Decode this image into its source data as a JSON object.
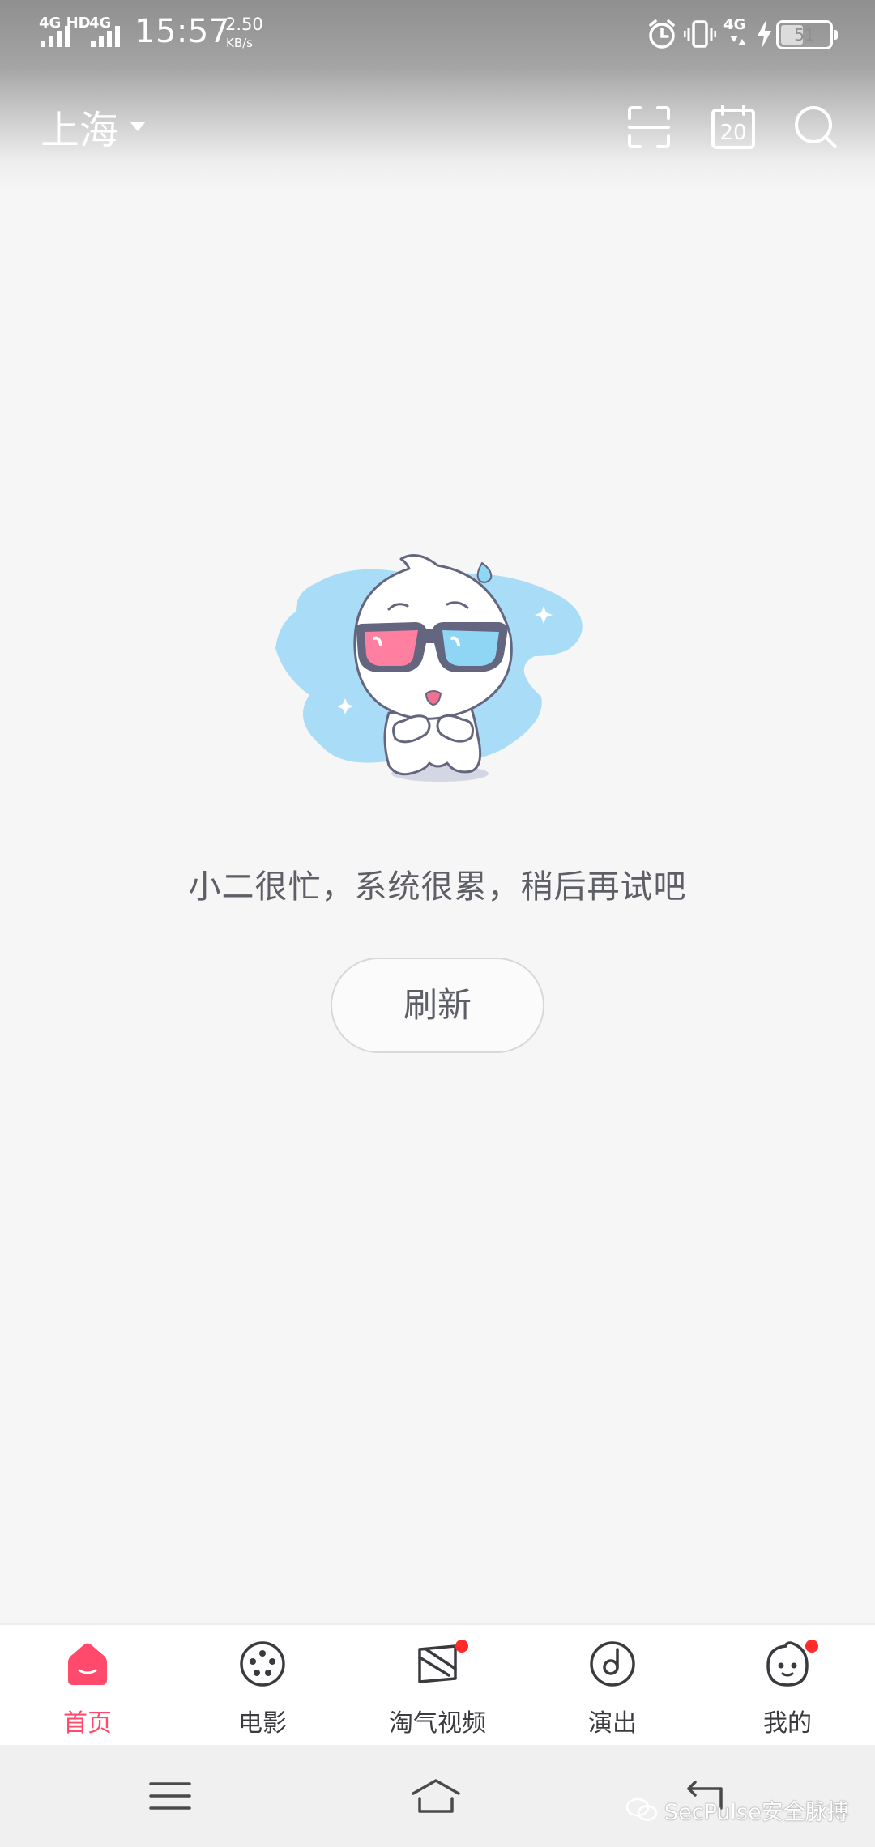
{
  "status_bar": {
    "sim1_label": "4G HD",
    "sim2_label": "4G",
    "time": "15:57",
    "speed_value": "2.50",
    "speed_unit": "KB/s",
    "network_right": "4G",
    "battery_level": "51"
  },
  "header": {
    "city": "上海",
    "calendar_day": "20",
    "icons": [
      "scan-icon",
      "calendar-icon",
      "search-icon"
    ]
  },
  "empty_state": {
    "message": "小二很忙，系统很累，稍后再试吧",
    "refresh_label": "刷新"
  },
  "tabs": [
    {
      "label": "首页",
      "icon": "home-icon",
      "active": true,
      "badge": false
    },
    {
      "label": "电影",
      "icon": "film-reel-icon",
      "active": false,
      "badge": false
    },
    {
      "label": "淘气视频",
      "icon": "video-icon",
      "active": false,
      "badge": true
    },
    {
      "label": "演出",
      "icon": "music-disc-icon",
      "active": false,
      "badge": false
    },
    {
      "label": "我的",
      "icon": "profile-face-icon",
      "active": false,
      "badge": true
    }
  ],
  "system_nav": [
    "menu-icon",
    "home-icon",
    "back-icon"
  ],
  "watermark": "SecPulse安全脉搏",
  "colors": {
    "accent": "#ff4a6b",
    "badge": "#ff2b2b",
    "mascot_blue": "#a9dcf6",
    "lens_pink": "#ff7fa0",
    "lens_blue": "#8fd6f5"
  }
}
